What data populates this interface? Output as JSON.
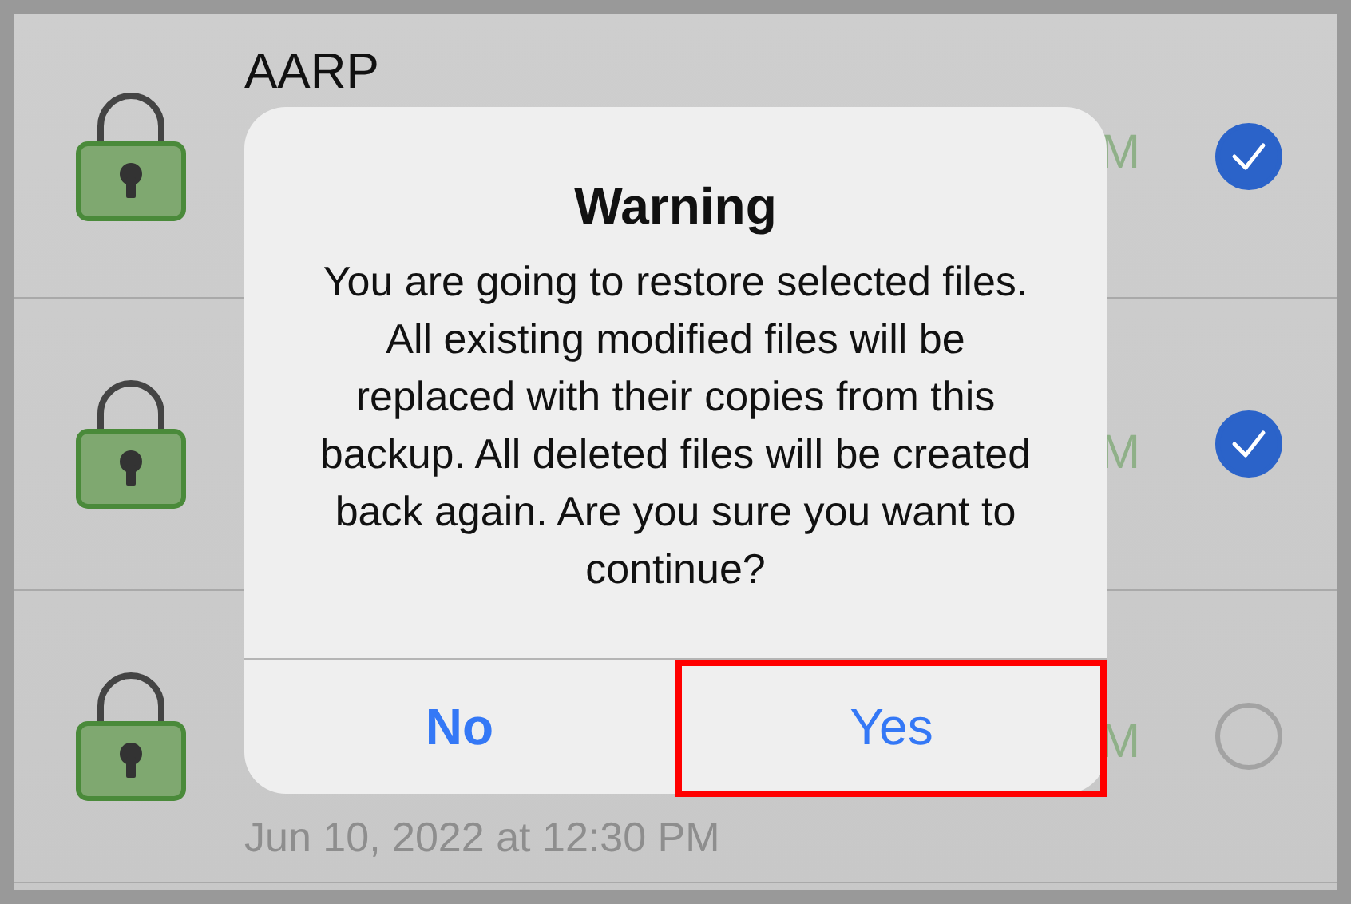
{
  "backups": [
    {
      "title": "AARP",
      "time_fragment": "M",
      "selected": true
    },
    {
      "time_fragment": "M",
      "selected": true
    },
    {
      "time_fragment": "M",
      "date": "Jun 10, 2022 at 12:30 PM",
      "selected": false
    }
  ],
  "alert": {
    "title": "Warning",
    "message": "You are going to restore selected files. All existing modified files will be replaced with their copies from this backup. All deleted files will be created back again. Are you sure you want to continue?",
    "buttons": [
      {
        "label": "No",
        "kind": "cancel",
        "highlighted": false
      },
      {
        "label": "Yes",
        "kind": "default",
        "highlighted": true
      }
    ]
  }
}
